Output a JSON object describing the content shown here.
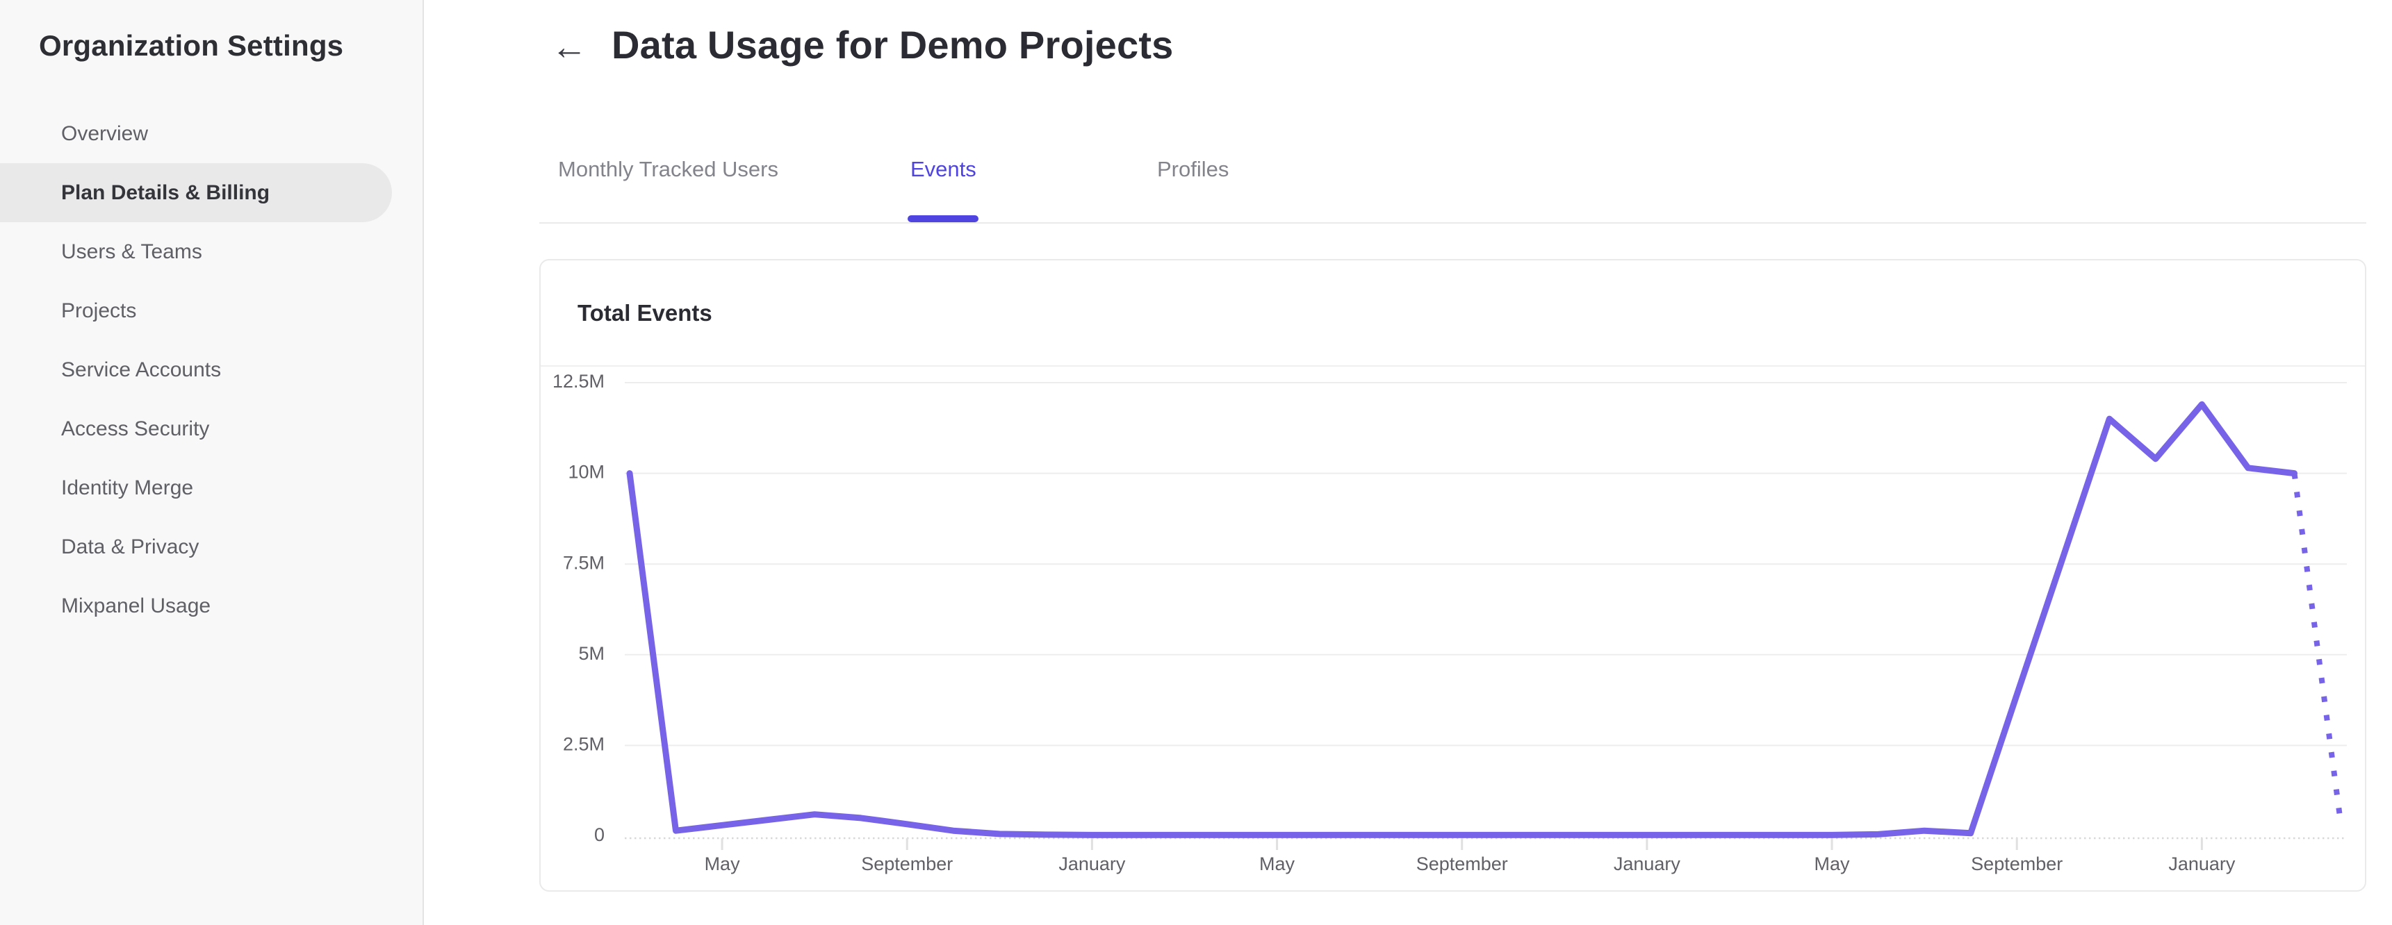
{
  "sidebar": {
    "title": "Organization Settings",
    "items": [
      {
        "label": "Overview",
        "active": false
      },
      {
        "label": "Plan Details & Billing",
        "active": true
      },
      {
        "label": "Users & Teams",
        "active": false
      },
      {
        "label": "Projects",
        "active": false
      },
      {
        "label": "Service Accounts",
        "active": false
      },
      {
        "label": "Access Security",
        "active": false
      },
      {
        "label": "Identity Merge",
        "active": false
      },
      {
        "label": "Data & Privacy",
        "active": false
      },
      {
        "label": "Mixpanel Usage",
        "active": false
      }
    ]
  },
  "header": {
    "back_icon": "←",
    "title": "Data Usage for Demo Projects"
  },
  "tabs": [
    {
      "label": "Monthly Tracked Users",
      "active": false
    },
    {
      "label": "Events",
      "active": true
    },
    {
      "label": "Profiles",
      "active": false
    }
  ],
  "card": {
    "title": "Total Events"
  },
  "colors": {
    "accent": "#4f44e0",
    "line": "#7763e8",
    "grid": "#ededed",
    "zero_dotted": "#d8d8d8",
    "tick": "#e0e0e0",
    "axis_text": "#606066"
  },
  "chart_data": {
    "type": "line",
    "title": "Total Events",
    "unit": "millions of events",
    "grid": "horizontal only",
    "legend": "none",
    "ylim": [
      0,
      12.5
    ],
    "y_ticks": [
      {
        "value": 0,
        "label": "0"
      },
      {
        "value": 2.5,
        "label": "2.5M"
      },
      {
        "value": 5,
        "label": "5M"
      },
      {
        "value": 7.5,
        "label": "7.5M"
      },
      {
        "value": 10,
        "label": "10M"
      },
      {
        "value": 12.5,
        "label": "12.5M"
      }
    ],
    "x_ticks": [
      {
        "index": 2,
        "label": "May"
      },
      {
        "index": 6,
        "label": "September"
      },
      {
        "index": 10,
        "label": "January"
      },
      {
        "index": 14,
        "label": "May"
      },
      {
        "index": 18,
        "label": "September"
      },
      {
        "index": 22,
        "label": "January"
      },
      {
        "index": 26,
        "label": "May"
      },
      {
        "index": 30,
        "label": "September"
      },
      {
        "index": 34,
        "label": "January"
      }
    ],
    "x_index_span": 37,
    "series": [
      {
        "name": "Total Events",
        "color": "#7763e8",
        "values_millions": [
          10,
          0.15,
          0.3,
          0.45,
          0.6,
          0.5,
          0.33,
          0.15,
          0.06,
          0.04,
          0.03,
          0.03,
          0.03,
          0.03,
          0.03,
          0.03,
          0.03,
          0.03,
          0.03,
          0.03,
          0.03,
          0.03,
          0.03,
          0.03,
          0.03,
          0.03,
          0.03,
          0.05,
          0.15,
          0.08,
          3.9,
          7.7,
          11.5,
          10.4,
          11.9,
          10.15,
          10
        ]
      }
    ],
    "projection_dashed": {
      "note": "dotted segment at right end of line",
      "points": [
        {
          "index": 36,
          "value_millions": 10
        },
        {
          "index": 37,
          "value_millions": 0.4
        }
      ]
    }
  }
}
